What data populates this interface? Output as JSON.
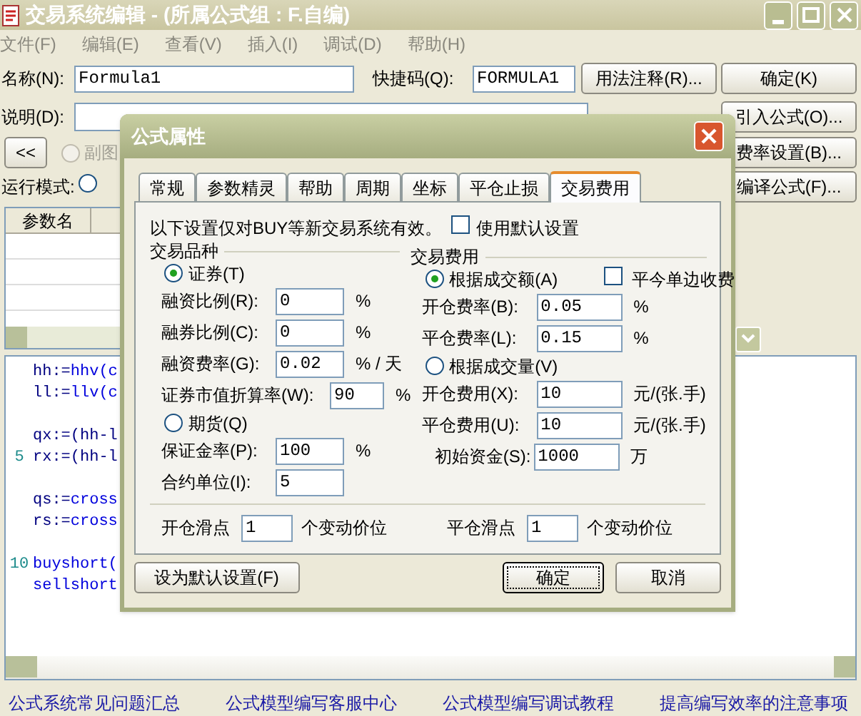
{
  "window": {
    "title": "交易系统编辑 - (所属公式组 : F.自编)"
  },
  "menu": [
    "文件(F)",
    "编辑(E)",
    "查看(V)",
    "插入(I)",
    "调试(D)",
    "帮助(H)"
  ],
  "name_field": {
    "label": "名称(N):",
    "value": "Formula1"
  },
  "shortcut_field": {
    "label": "快捷码(Q):",
    "value": "FORMULA1"
  },
  "description_field": {
    "label": "说明(D):"
  },
  "right_buttons": [
    "用法注释(R)...",
    "确定(K)",
    "引入公式(O)...",
    "费率设置(B)...",
    "编译公式(F)..."
  ],
  "collapse_button": "<<",
  "subchart_radio": {
    "label": "副图",
    "selected": false,
    "disabled": true
  },
  "run_mode": {
    "label": "运行模式:",
    "selected": false
  },
  "param_table": {
    "columns": [
      "参数名"
    ]
  },
  "code_blocks": [
    [
      {
        "text": "hh:=hhv(c"
      },
      {
        "text": "ll:=llv(c"
      }
    ],
    [
      {
        "text": "qx:=(hh-l"
      },
      {
        "number": "5",
        "text": "rx:=(hh-l"
      }
    ],
    [
      {
        "text": "qs:=cross"
      },
      {
        "text": "rs:=cross"
      }
    ],
    [
      {
        "number": "10",
        "text": "buyshort("
      },
      {
        "text": "sellshort"
      }
    ]
  ],
  "links": [
    "公式系统常见问题汇总",
    "公式模型编写客服中心",
    "公式模型编写调试教程",
    "提高编写效率的注意事项"
  ],
  "dialog": {
    "title": "公式属性",
    "tabs": [
      {
        "label": "常规",
        "selected": false
      },
      {
        "label": "参数精灵",
        "selected": false
      },
      {
        "label": "帮助",
        "selected": false
      },
      {
        "label": "周期",
        "selected": false
      },
      {
        "label": "坐标",
        "selected": false
      },
      {
        "label": "平仓止损",
        "selected": false
      },
      {
        "label": "交易费用",
        "selected": true
      }
    ],
    "note": "以下设置仅对BUY等新交易系统有效。",
    "use_default": {
      "label": "使用默认设置",
      "checked": false
    },
    "left_group": {
      "title": "交易品种",
      "items": [
        {
          "kind": "radio",
          "label": "证券(T)",
          "selected": true
        },
        {
          "kind": "field",
          "label": "融资比例(R):",
          "value": "0",
          "unit": "%"
        },
        {
          "kind": "field",
          "label": "融券比例(C):",
          "value": "0",
          "unit": "%"
        },
        {
          "kind": "field",
          "label": "融资费率(G):",
          "value": "0.02",
          "unit": "% / 天"
        },
        {
          "kind": "wide_field",
          "label": "证券市值折算率(W):",
          "value": "90",
          "unit": "%"
        },
        {
          "kind": "radio",
          "label": "期货(Q)",
          "selected": false
        },
        {
          "kind": "field",
          "label": "保证金率(P):",
          "value": "100",
          "unit": "%"
        },
        {
          "kind": "field",
          "label": "合约单位(I):",
          "value": "5"
        }
      ]
    },
    "right_group": {
      "title": "交易费用",
      "items": [
        {
          "kind": "radio",
          "label": "根据成交额(A)",
          "selected": true,
          "checkbox": {
            "label": "平今单边收费",
            "checked": false
          }
        },
        {
          "kind": "field",
          "label": "开仓费率(B):",
          "value": "0.05",
          "unit": "%"
        },
        {
          "kind": "field",
          "label": "平仓费率(L):",
          "value": "0.15",
          "unit": "%"
        },
        {
          "kind": "radio",
          "label": "根据成交量(V)",
          "selected": false
        },
        {
          "kind": "field",
          "label": "开仓费用(X):",
          "value": "10",
          "unit": "元/(张.手)"
        },
        {
          "kind": "field",
          "label": "平仓费用(U):",
          "value": "10",
          "unit": "元/(张.手)"
        },
        {
          "kind": "outdent_field",
          "label": "初始资金(S):",
          "value": "1000",
          "unit": "万"
        }
      ]
    },
    "slippage": [
      {
        "label": "开仓滑点",
        "value": "1",
        "unit": "个变动价位"
      },
      {
        "label": "平仓滑点",
        "value": "1",
        "unit": "个变动价位"
      }
    ],
    "buttons": [
      {
        "label": "设为默认设置(F)",
        "kind": "secondary"
      },
      {
        "label": "确定",
        "kind": "default"
      },
      {
        "label": "取消",
        "kind": "normal"
      }
    ]
  }
}
